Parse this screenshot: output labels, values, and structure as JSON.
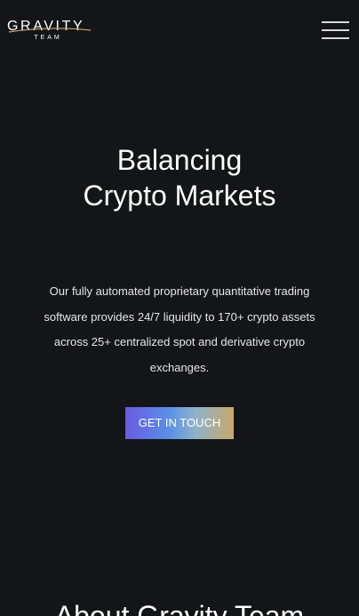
{
  "header": {
    "logo_text": "GRAVITY",
    "logo_subtext": "TEAM",
    "menu_icon": "hamburger-icon"
  },
  "hero": {
    "title_line1": "Balancing",
    "title_line2": "Crypto Markets",
    "description": "Our fully automated proprietary quantitative trading software provides 24/7 liquidity to 170+ crypto assets across 25+ centralized spot and derivative crypto exchanges.",
    "cta_label": "GET IN TOUCH"
  },
  "about": {
    "heading": "About Gravity Team"
  },
  "colors": {
    "background": "#141518",
    "text": "#ffffff",
    "cta_gradient_start": "#6a5be0",
    "cta_gradient_end": "#c9a76a",
    "logo_swoosh": "#c9a76a"
  }
}
